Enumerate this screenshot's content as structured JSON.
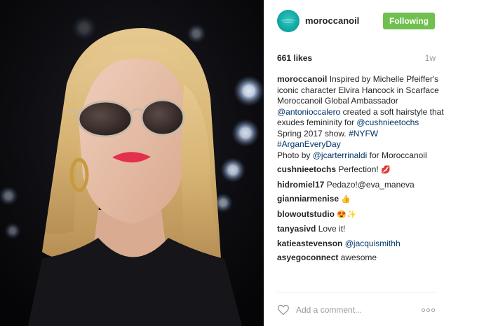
{
  "post": {
    "username": "moroccanoil",
    "follow_label": "Following",
    "likes": "661 likes",
    "time_ago": "1w",
    "caption": {
      "username": "moroccanoil",
      "text_1": "Inspired by Michelle Pfeiffer's iconic character Elvira Hancock in Scarface Moroccanoil Global Ambassador",
      "mention_1": "@antonioccalero",
      "text_2": "created a soft hairstyle that exudes femininity for",
      "mention_2": "@cushnieetochs",
      "text_3": "Spring 2017 show.",
      "hashtag_1": "#NYFW",
      "hashtag_2": "#ArganEveryDay",
      "text_4": "Photo by",
      "mention_3": "@jcarterrinaldi",
      "text_5": "for Moroccanoil"
    },
    "comments": [
      {
        "user": "cushnieetochs",
        "text": "Perfection!",
        "emoji": "lips-emoji"
      },
      {
        "user": "hidromiel17",
        "text": "Pedazo!@eva_maneva",
        "emoji": ""
      },
      {
        "user": "gianniarmenise",
        "text": "",
        "emoji": "thumbs-up-emoji"
      },
      {
        "user": "blowoutstudio",
        "text": "",
        "emoji": "smile-sparkle-emoji"
      },
      {
        "user": "tanyasivd",
        "text": "Love it!",
        "emoji": ""
      },
      {
        "user": "katieastevenson",
        "text": "@jacquismithh",
        "emoji": ""
      },
      {
        "user": "asyegoconnect",
        "text": "awesome",
        "emoji": ""
      }
    ],
    "add_comment_placeholder": "Add a comment...",
    "icons": {
      "like": "heart-icon",
      "more": "more-options-icon",
      "avatar": "moroccanoil-logo-avatar"
    },
    "colors": {
      "follow_button": "#70c050",
      "link": "#003569",
      "muted": "#999999",
      "avatar": "#13a7a3"
    }
  }
}
